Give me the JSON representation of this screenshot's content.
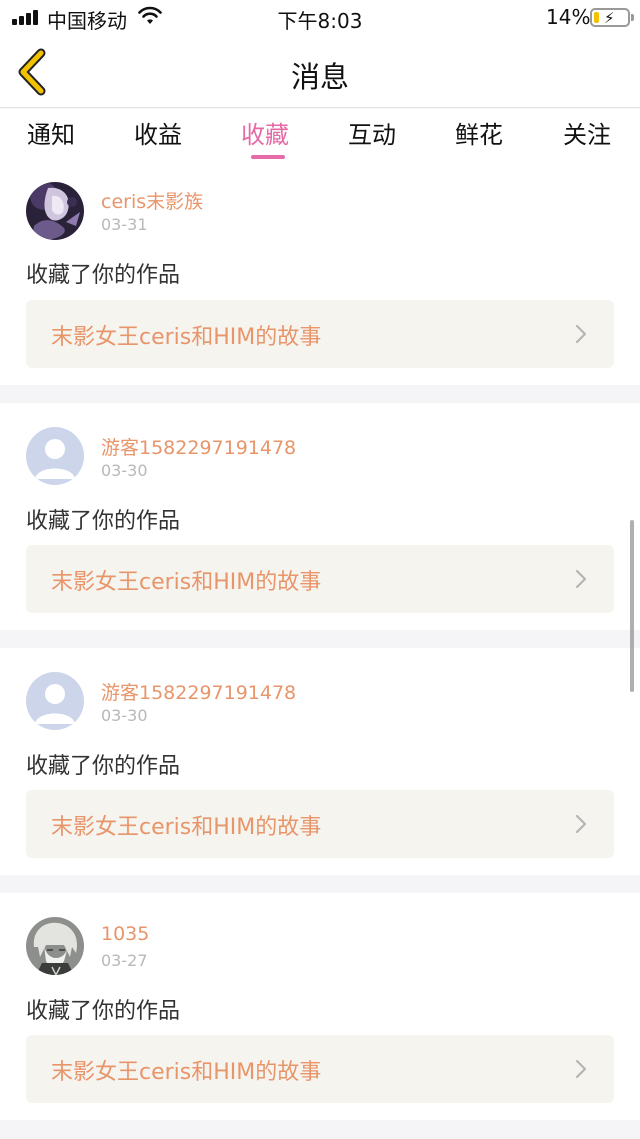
{
  "status_bar": {
    "carrier": "中国移动",
    "time": "下午8:03",
    "battery_percent": "14%"
  },
  "nav": {
    "title": "消息",
    "back_icon": "chevron-left-icon",
    "back_color": "#f2c200"
  },
  "tabs": [
    {
      "label": "通知",
      "active": false
    },
    {
      "label": "收益",
      "active": false
    },
    {
      "label": "收藏",
      "active": true
    },
    {
      "label": "互动",
      "active": false
    },
    {
      "label": "鲜花",
      "active": false
    },
    {
      "label": "关注",
      "active": false
    }
  ],
  "colors": {
    "accent_tab": "#e56aa6",
    "name_orange": "#e8956a",
    "work_bg": "#f6f4ef"
  },
  "messages": [
    {
      "user": "ceris末影族",
      "date": "03-31",
      "action": "收藏了你的作品",
      "work_title": "末影女王ceris和HIM的故事",
      "avatar": "anime-avatar-dark-purple"
    },
    {
      "user": "游客1582297191478",
      "date": "03-30",
      "action": "收藏了你的作品",
      "work_title": "末影女王ceris和HIM的故事",
      "avatar": "default-user-avatar"
    },
    {
      "user": "游客1582297191478",
      "date": "03-30",
      "action": "收藏了你的作品",
      "work_title": "末影女王ceris和HIM的故事",
      "avatar": "default-user-avatar"
    },
    {
      "user": "1035",
      "date": "03-27",
      "action": "收藏了你的作品",
      "work_title": "末影女王ceris和HIM的故事",
      "avatar": "sketch-anime-avatar"
    }
  ]
}
